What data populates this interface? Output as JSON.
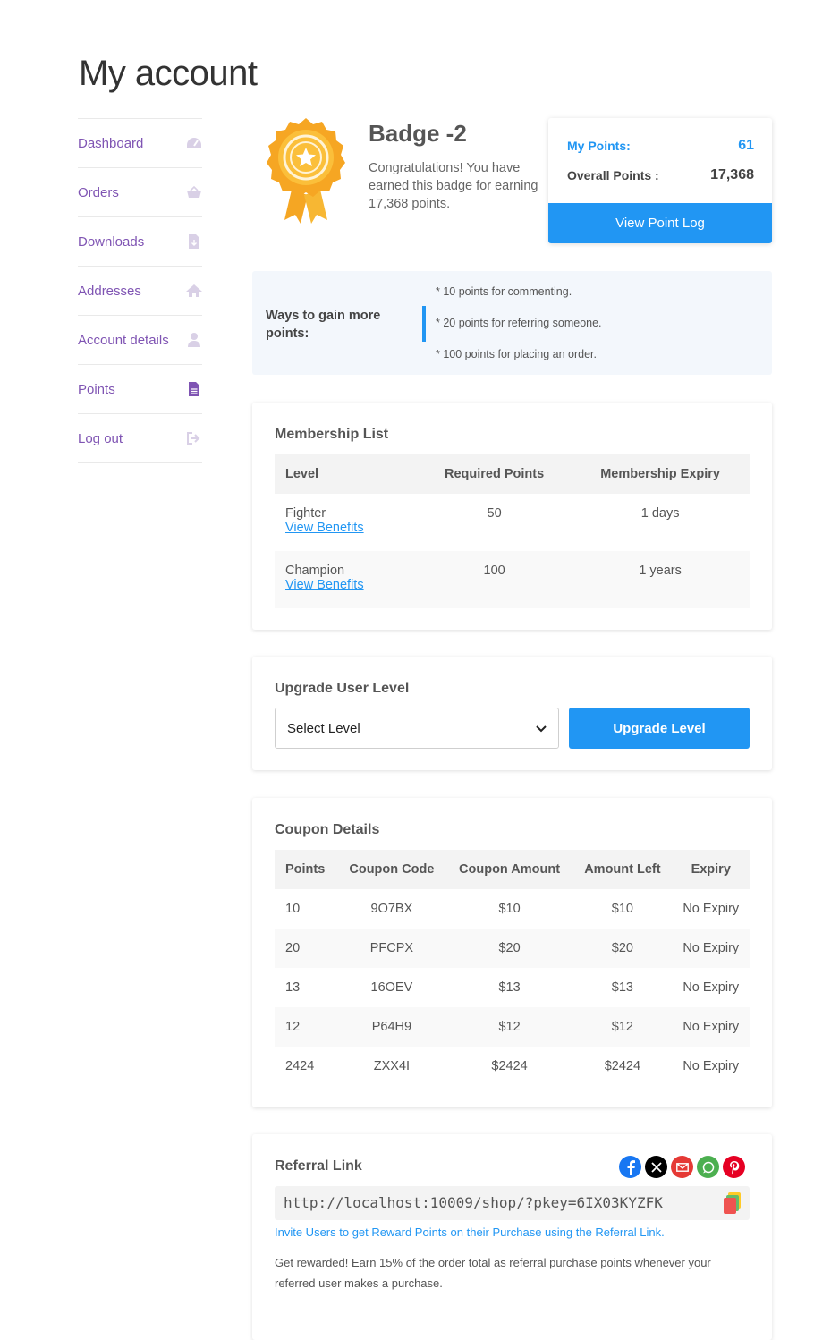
{
  "page": {
    "title": "My account"
  },
  "sidebar": {
    "items": [
      {
        "label": "Dashboard",
        "icon": "dashboard-gauge-icon"
      },
      {
        "label": "Orders",
        "icon": "basket-icon"
      },
      {
        "label": "Downloads",
        "icon": "file-download-icon"
      },
      {
        "label": "Addresses",
        "icon": "home-icon"
      },
      {
        "label": "Account details",
        "icon": "user-icon"
      },
      {
        "label": "Points",
        "icon": "document-icon",
        "active": true
      },
      {
        "label": "Log out",
        "icon": "sign-out-icon"
      }
    ]
  },
  "badge": {
    "title": "Badge -2",
    "description": "Congratulations! You have earned this badge for earning 17,368 points."
  },
  "points": {
    "my_points_label": "My Points:",
    "my_points_value": "61",
    "overall_label": "Overall Points :",
    "overall_value": "17,368",
    "log_button": "View Point Log"
  },
  "ways": {
    "title": "Ways to gain more points:",
    "items": [
      "* 10 points for commenting.",
      "* 20 points for referring someone.",
      "* 100 points for placing an order."
    ]
  },
  "membership": {
    "title": "Membership List",
    "headers": [
      "Level",
      "Required Points",
      "Membership Expiry"
    ],
    "rows": [
      {
        "level": "Fighter",
        "link": "View Benefits",
        "points": "50",
        "expiry": "1 days"
      },
      {
        "level": "Champion",
        "link": "View Benefits",
        "points": "100",
        "expiry": "1 years"
      }
    ]
  },
  "upgrade": {
    "title": "Upgrade User Level",
    "select_value": "Select Level",
    "button": "Upgrade Level"
  },
  "coupons": {
    "title": "Coupon Details",
    "headers": [
      "Points",
      "Coupon Code",
      "Coupon Amount",
      "Amount Left",
      "Expiry"
    ],
    "rows": [
      [
        "10",
        "9O7BX",
        "$10",
        "$10",
        "No Expiry"
      ],
      [
        "20",
        "PFCPX",
        "$20",
        "$20",
        "No Expiry"
      ],
      [
        "13",
        "16OEV",
        "$13",
        "$13",
        "No Expiry"
      ],
      [
        "12",
        "P64H9",
        "$12",
        "$12",
        "No Expiry"
      ],
      [
        "2424",
        "ZXX4I",
        "$2424",
        "$2424",
        "No Expiry"
      ]
    ]
  },
  "referral": {
    "title": "Referral Link",
    "url": "http://localhost:10009/shop/?pkey=6IX03KYZFK",
    "invite_text": "Invite Users to get Reward Points on their Purchase using the Referral Link.",
    "note": "Get rewarded! Earn 15% of the order total as referral purchase points whenever your referred user makes a purchase.",
    "share": [
      {
        "icon": "facebook-icon",
        "color": "#1877f2"
      },
      {
        "icon": "x-twitter-icon",
        "color": "#000000"
      },
      {
        "icon": "email-icon",
        "color": "#e53935"
      },
      {
        "icon": "whatsapp-icon",
        "color": "#4caf50"
      },
      {
        "icon": "pinterest-icon",
        "color": "#e60023"
      }
    ]
  },
  "colors": {
    "accent": "#2196f3",
    "link_purple": "#7f54b3"
  }
}
